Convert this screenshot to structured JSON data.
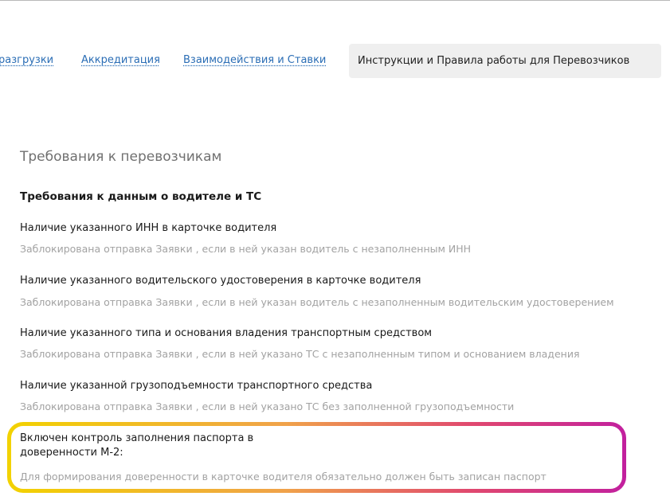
{
  "tabs": {
    "items": [
      {
        "label": "разгрузки"
      },
      {
        "label": "Аккредитация"
      },
      {
        "label": "Взаимодействия и Ставки"
      }
    ],
    "active": {
      "label": "Инструкции и Правила работы для Перевозчиков"
    }
  },
  "section": {
    "title": "Требования к перевозчикам",
    "group_title": "Требования к данным о водителе и ТС",
    "requirements": [
      {
        "title": "Наличие указанного ИНН в карточке водителя",
        "description": "Заблокирована отправка Заявки , если в ней указан водитель с незаполненным ИНН"
      },
      {
        "title": "Наличие указанного водительского удостоверения в карточке водителя",
        "description": "Заблокирована отправка Заявки , если в ней указан водитель с незаполненным водительским удостоверением"
      },
      {
        "title": "Наличие указанного типа и основания владения транспортным средством",
        "description": "Заблокирована отправка Заявки , если в ней указано ТС с незаполненным типом и основанием владения"
      },
      {
        "title": "Наличие указанной грузоподъемности транспортного средства",
        "description": "Заблокирована отправка Заявки , если в ней указано ТС без заполненной грузоподъемности"
      }
    ],
    "highlighted": {
      "title": "Включен контроль заполнения паспорта в доверенности М-2:",
      "description": "Для формирования доверенности в карточке водителя обязательно должен быть записан паспорт"
    }
  },
  "colors": {
    "link": "#2a6db5",
    "active_tab_bg": "#efefef",
    "muted_text": "#a2a2a2",
    "highlight_gradient": [
      "#f2d200",
      "#f0a24a",
      "#e0486f",
      "#c2209e"
    ]
  }
}
